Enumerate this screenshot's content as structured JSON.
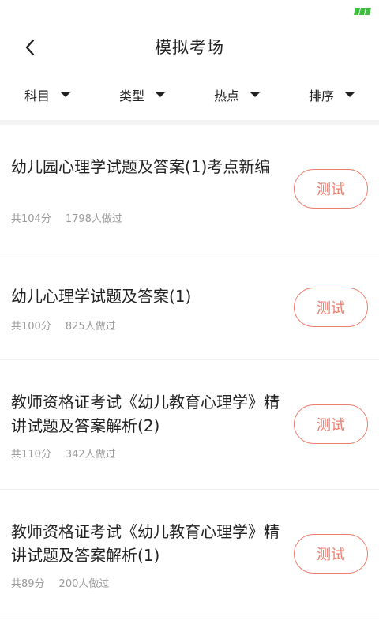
{
  "header": {
    "title": "模拟考场"
  },
  "filters": [
    {
      "label": "科目"
    },
    {
      "label": "类型"
    },
    {
      "label": "热点"
    },
    {
      "label": "排序"
    }
  ],
  "exams": [
    {
      "title": "幼儿园心理学试题及答案(1)考点新编",
      "score": "共104分",
      "count": "1798人做过",
      "action": "测试"
    },
    {
      "title": "幼儿心理学试题及答案(1)",
      "score": "共100分",
      "count": "825人做过",
      "action": "测试"
    },
    {
      "title": "教师资格证考试《幼儿教育心理学》精讲试题及答案解析(2)",
      "score": "共110分",
      "count": "342人做过",
      "action": "测试"
    },
    {
      "title": "教师资格证考试《幼儿教育心理学》精讲试题及答案解析(1)",
      "score": "共89分",
      "count": "200人做过",
      "action": "测试"
    }
  ],
  "colors": {
    "accent": "#ee7d6c",
    "battery": "#3fbf3f"
  }
}
